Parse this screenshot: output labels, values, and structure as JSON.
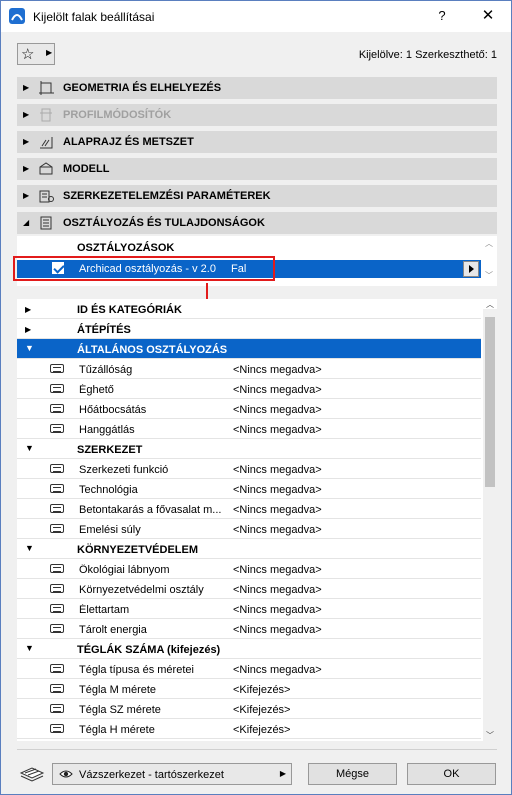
{
  "window": {
    "title": "Kijelölt falak beállításai",
    "help_label": "?",
    "close_label": "✕"
  },
  "toolbar": {
    "favorites_icon": "star-icon",
    "selection_info": "Kijelölve: 1 Szerkeszthető: 1"
  },
  "sections": [
    {
      "label": "GEOMETRIA ÉS ELHELYEZÉS",
      "icon": "geometry-icon",
      "enabled": true
    },
    {
      "label": "PROFILMÓDOSÍTÓK",
      "icon": "profile-modifier-icon",
      "enabled": false
    },
    {
      "label": "ALAPRAJZ ÉS METSZET",
      "icon": "floor-plan-icon",
      "enabled": true
    },
    {
      "label": "MODELL",
      "icon": "model-icon",
      "enabled": true
    },
    {
      "label": "SZERKEZETELEMZÉSI PARAMÉTEREK",
      "icon": "structural-analysis-icon",
      "enabled": true
    },
    {
      "label": "OSZTÁLYOZÁS ÉS TULAJDONSÁGOK",
      "icon": "classification-icon",
      "enabled": true
    }
  ],
  "classifications": {
    "header": "OSZTÁLYOZÁSOK",
    "row": {
      "name": "Archicad osztályozás - v 2.0",
      "value": "Fal",
      "checked": true
    }
  },
  "properties": [
    {
      "kind": "group",
      "label": "ID ÉS KATEGÓRIÁK",
      "open": false,
      "selected": false
    },
    {
      "kind": "group",
      "label": "ÁTÉPÍTÉS",
      "open": false,
      "selected": false
    },
    {
      "kind": "group",
      "label": "ÁLTALÁNOS OSZTÁLYOZÁS",
      "open": true,
      "selected": true
    },
    {
      "kind": "item",
      "name": "Tűzállóság",
      "value": "<Nincs megadva>"
    },
    {
      "kind": "item",
      "name": "Éghető",
      "value": "<Nincs megadva>"
    },
    {
      "kind": "item",
      "name": "Hőátbocsátás",
      "value": "<Nincs megadva>"
    },
    {
      "kind": "item",
      "name": "Hanggátlás",
      "value": "<Nincs megadva>"
    },
    {
      "kind": "group",
      "label": "SZERKEZET",
      "open": true,
      "selected": false
    },
    {
      "kind": "item",
      "name": "Szerkezeti funkció",
      "value": "<Nincs megadva>"
    },
    {
      "kind": "item",
      "name": "Technológia",
      "value": "<Nincs megadva>"
    },
    {
      "kind": "item",
      "name": "Betontakarás a fővasalat m...",
      "value": "<Nincs megadva>"
    },
    {
      "kind": "item",
      "name": "Emelési súly",
      "value": "<Nincs megadva>"
    },
    {
      "kind": "group",
      "label": "KÖRNYEZETVÉDELEM",
      "open": true,
      "selected": false
    },
    {
      "kind": "item",
      "name": "Ökológiai lábnyom",
      "value": "<Nincs megadva>"
    },
    {
      "kind": "item",
      "name": "Környezetvédelmi osztály",
      "value": "<Nincs megadva>"
    },
    {
      "kind": "item",
      "name": "Élettartam",
      "value": "<Nincs megadva>"
    },
    {
      "kind": "item",
      "name": "Tárolt energia",
      "value": "<Nincs megadva>"
    },
    {
      "kind": "group",
      "label": "TÉGLÁK SZÁMA (kifejezés)",
      "open": true,
      "selected": false
    },
    {
      "kind": "item",
      "name": "Tégla típusa és méretei",
      "value": "<Nincs megadva>"
    },
    {
      "kind": "item",
      "name": "Tégla M mérete",
      "value": "<Kifejezés>"
    },
    {
      "kind": "item",
      "name": "Tégla SZ mérete",
      "value": "<Kifejezés>"
    },
    {
      "kind": "item",
      "name": "Tégla H mérete",
      "value": "<Kifejezés>"
    }
  ],
  "footer": {
    "layer_icon": "layer-icon",
    "view_icon": "eye-icon",
    "view_label": "Vázszerkezet - tartószerkezet",
    "cancel_label": "Mégse",
    "ok_label": "OK"
  },
  "colors": {
    "selection": "#0a64c8",
    "highlight_frame": "#e21b1b",
    "section_bg": "#d9d9d9"
  }
}
